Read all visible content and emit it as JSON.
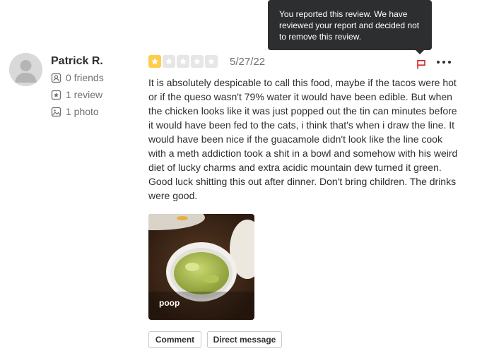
{
  "tooltip": {
    "text": "You reported this review. We have reviewed your report and decided not to remove this review."
  },
  "user": {
    "name": "Patrick R.",
    "friends": "0 friends",
    "reviews": "1 review",
    "photos": "1 photo"
  },
  "review": {
    "rating": 1,
    "max_rating": 5,
    "date": "5/27/22",
    "text": "It is absolutely despicable to call this food, maybe if the tacos were hot or if the queso wasn't 79% water it would have been edible. But when the chicken looks like it was just popped out the tin can minutes before it would have been fed to the cats, i think that's when i draw the line. It would have been nice if the guacamole didn't look like the line cook with a meth addiction took a shit in a bowl and somehow with his weird diet of lucky charms and extra acidic mountain dew turned it green. Good luck shitting this out after dinner. Don't bring children. The drinks were good.",
    "photo_caption": "poop"
  },
  "actions": {
    "comment_label": "Comment",
    "direct_message_label": "Direct message"
  },
  "colors": {
    "star_filled": "#ffcc4b",
    "star_empty": "#e6e6e6",
    "flag_red": "#d32323",
    "tooltip_bg": "#2d2e2f"
  },
  "icons": {
    "friends": "friends-icon",
    "review": "review-star-icon",
    "photo": "photo-icon",
    "flag": "flag-icon",
    "more": "more-options-icon"
  }
}
